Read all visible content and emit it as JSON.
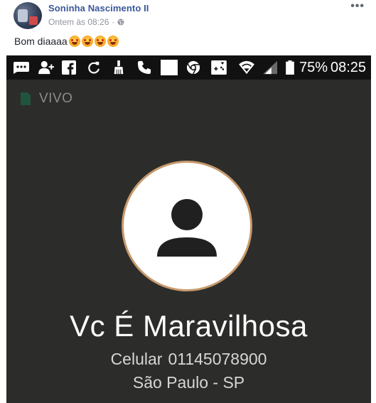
{
  "post": {
    "author": "Soninha Nascimento II",
    "timestamp": "Ontem às 08:26",
    "privacy_icon": "globe-icon",
    "more_options": "•••",
    "caption": "Bom diaaaa",
    "emojis": [
      "smiling-cat-emoji",
      "smiling-cat-emoji",
      "smiling-cat-emoji",
      "smiling-cat-emoji"
    ]
  },
  "phone": {
    "statusbar": {
      "icons": [
        "sms-icon",
        "add-contact-icon",
        "facebook-icon",
        "sync-icon",
        "clean-icon",
        "phone-icon",
        "blank-notification-icon",
        "chrome-icon",
        "game-icon",
        "wifi-icon",
        "signal-icon",
        "battery-icon"
      ],
      "battery": "75%",
      "time": "08:25"
    },
    "carrier": "VIVO",
    "contact": {
      "name": "Vc É Maravilhosa",
      "phone_label": "Celular",
      "phone_number": "01145078900",
      "location": "São Paulo - SP"
    }
  },
  "colors": {
    "author_link": "#385898",
    "meta_text": "#90949c",
    "screen_bg": "#2c2d2b",
    "statusbar_bg": "#111111",
    "avatar_ring": "#c79a6d",
    "sim_green": "#21543f"
  }
}
